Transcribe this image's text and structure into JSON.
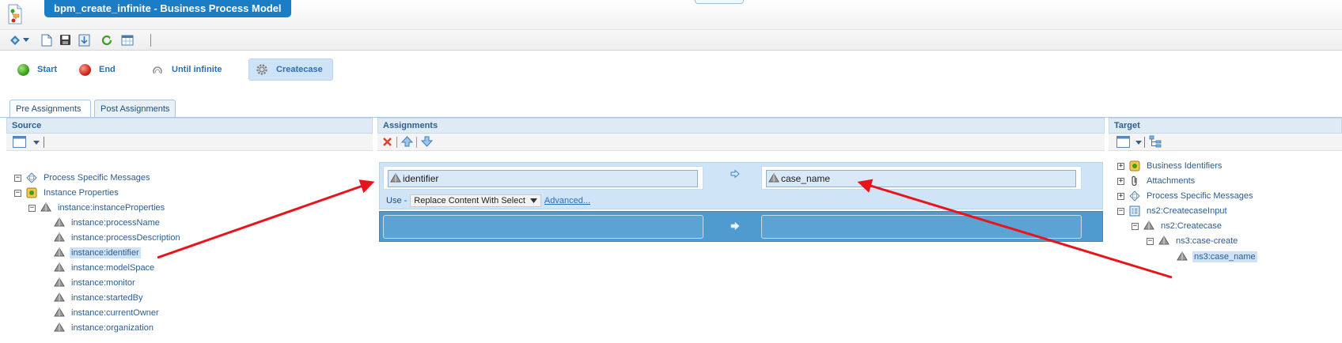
{
  "window": {
    "title": "bpm_create_infinite - Business Process Model"
  },
  "toolbar": {
    "icons": [
      "model-icon",
      "dropdown-arrow-icon",
      "new-page-icon",
      "save-icon",
      "export-icon",
      "refresh-icon",
      "grid-icon"
    ]
  },
  "flow": {
    "nodes": [
      {
        "label": "Start",
        "icon": "start-dot-icon",
        "color": "#3aa11e"
      },
      {
        "label": "End",
        "icon": "end-dot-icon",
        "color": "#d0271c"
      },
      {
        "label": "Until infinite",
        "icon": "loop-icon"
      },
      {
        "label": "Createcase",
        "icon": "gear-icon",
        "selected": true
      }
    ]
  },
  "tabs": [
    {
      "label": "Pre Assignments",
      "active": true
    },
    {
      "label": "Post Assignments",
      "active": false
    }
  ],
  "source": {
    "header": "Source",
    "tree": [
      {
        "label": "Process Specific Messages",
        "expander": "-"
      },
      {
        "label": "Instance Properties",
        "expander": "-"
      },
      {
        "label": "instance:instanceProperties",
        "expander": "-"
      },
      {
        "label": "instance:processName"
      },
      {
        "label": "instance:processDescription"
      },
      {
        "label": "instance:identifier",
        "highlighted": true
      },
      {
        "label": "instance:modelSpace"
      },
      {
        "label": "instance:monitor"
      },
      {
        "label": "instance:startedBy"
      },
      {
        "label": "instance:currentOwner"
      },
      {
        "label": "instance:organization"
      }
    ]
  },
  "assignments": {
    "header": "Assignments",
    "rows": [
      {
        "source_value": "identifier",
        "target_value": "case_name",
        "use_label": "Use -",
        "use_option": "Replace Content With Select",
        "advanced_label": "Advanced..."
      },
      {
        "source_value": "",
        "target_value": ""
      }
    ]
  },
  "target": {
    "header": "Target",
    "tree": [
      {
        "label": "Business Identifiers",
        "expander": "+"
      },
      {
        "label": "Attachments",
        "expander": "+"
      },
      {
        "label": "Process Specific Messages",
        "expander": "+"
      },
      {
        "label": "ns2:CreatecaseInput",
        "expander": "-"
      },
      {
        "label": "ns2:Createcase",
        "expander": "-"
      },
      {
        "label": "ns3:case-create",
        "expander": "-"
      },
      {
        "label": "ns3:case_name",
        "highlighted": true
      }
    ]
  },
  "annotations": {
    "arrow_color": "#e8141b"
  }
}
